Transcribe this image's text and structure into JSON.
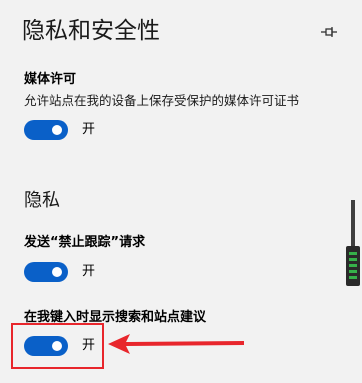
{
  "page": {
    "title": "隐私和安全性"
  },
  "media_license": {
    "label": "媒体许可",
    "description": "允许站点在我的设备上保存受保护的媒体许可证书",
    "toggle_state": "开",
    "on": true
  },
  "privacy": {
    "heading": "隐私",
    "dnt": {
      "label": "发送“禁止跟踪”请求",
      "toggle_state": "开",
      "on": true
    },
    "suggestions": {
      "label": "在我键入时显示搜索和站点建议",
      "toggle_state": "开",
      "on": true
    }
  },
  "icons": {
    "pin": "pin-icon",
    "annotation_arrow": "arrow-left-icon"
  },
  "colors": {
    "toggle_on": "#0a60c8",
    "annotation": "#e8262c",
    "background": "#f2f2f2"
  }
}
